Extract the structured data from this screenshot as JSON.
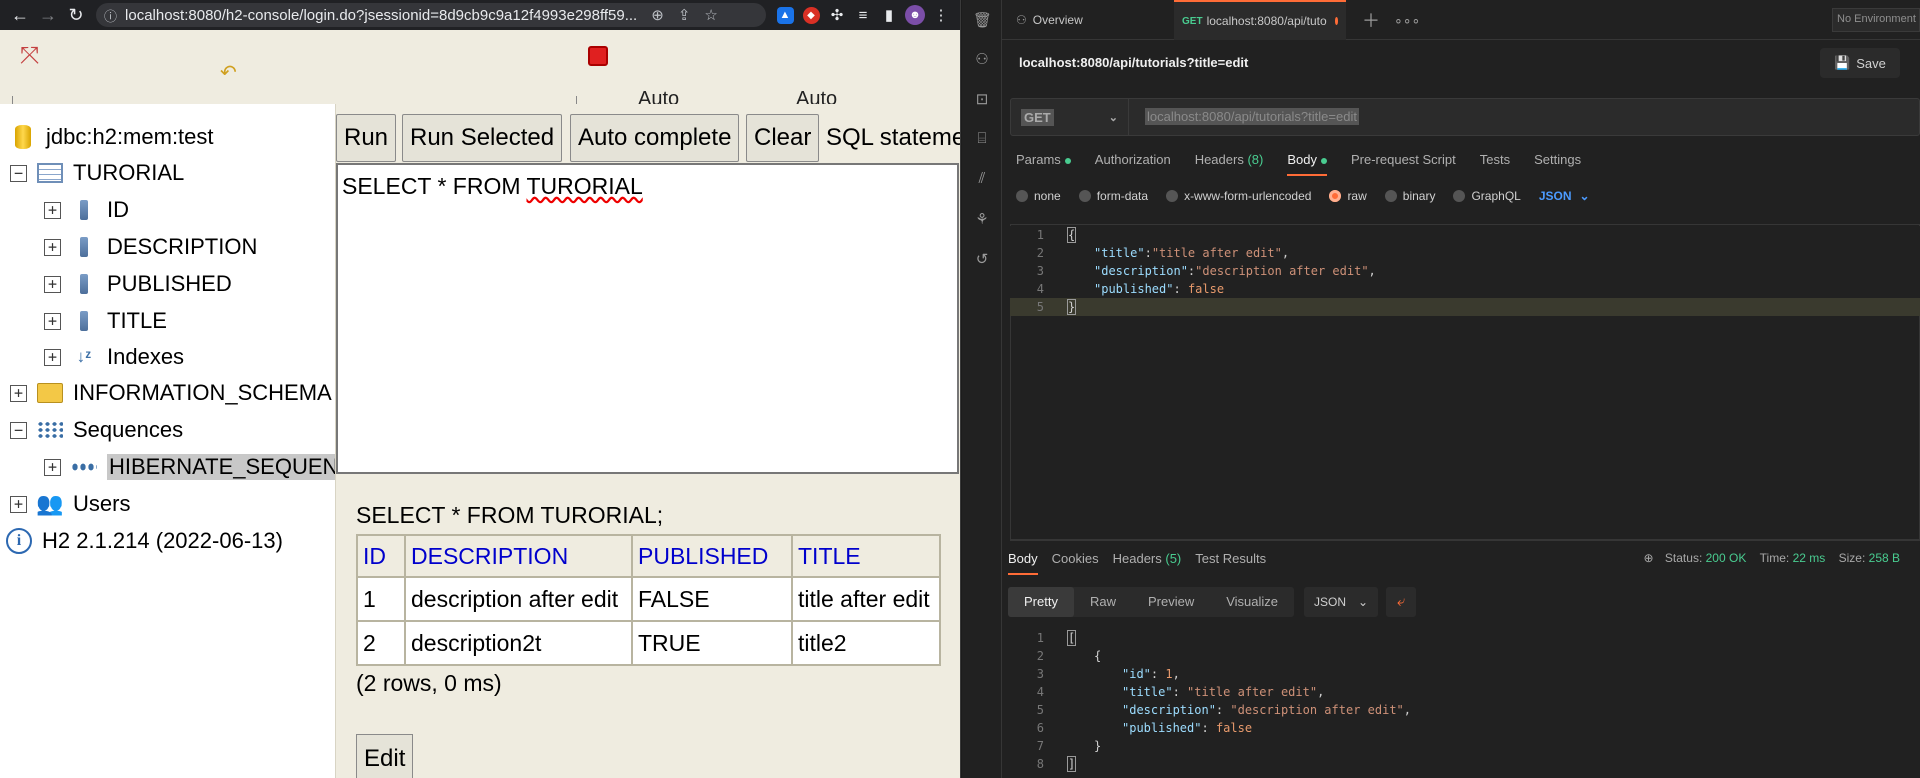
{
  "browser": {
    "url": "localhost:8080/h2-console/login.do?jsessionid=8d9cb9c9a12f4993e298ff59..."
  },
  "h2": {
    "toolbar": {
      "auto1": "Auto",
      "auto2": "Auto"
    },
    "tree": {
      "connection": "jdbc:h2:mem:test",
      "table": "TURORIAL",
      "columns": [
        "ID",
        "DESCRIPTION",
        "PUBLISHED",
        "TITLE"
      ],
      "indexes": "Indexes",
      "info_schema": "INFORMATION_SCHEMA",
      "sequences": "Sequences",
      "sequence_item": "HIBERNATE_SEQUENCE",
      "users": "Users",
      "version": "H2 2.1.214 (2022-06-13)"
    },
    "buttons": {
      "run": "Run",
      "run_selected": "Run Selected",
      "auto_complete": "Auto complete",
      "clear": "Clear",
      "sql_label": "SQL statement:",
      "edit": "Edit"
    },
    "editor": {
      "keyword": "SELECT * FROM ",
      "table": "TURORIAL"
    },
    "result": {
      "statement": "SELECT * FROM TURORIAL;",
      "columns": [
        "ID",
        "DESCRIPTION",
        "PUBLISHED",
        "TITLE"
      ],
      "rows": [
        [
          "1",
          "description after edit",
          "FALSE",
          "title after edit"
        ],
        [
          "2",
          "description2t",
          "TRUE",
          "title2"
        ]
      ],
      "footer": "(2 rows, 0 ms)"
    }
  },
  "postman": {
    "tabs": {
      "overview": "Overview",
      "active_method": "GET",
      "active_label": "localhost:8080/api/tuto"
    },
    "environment": "No Environment",
    "title": "localhost:8080/api/tutorials?title=edit",
    "save": "Save",
    "method": "GET",
    "url": "localhost:8080/api/tutorials?title=edit",
    "request_tabs": {
      "params": "Params",
      "authorization": "Authorization",
      "headers": "Headers",
      "headers_count": "(8)",
      "body": "Body",
      "prerequest": "Pre-request Script",
      "tests": "Tests",
      "settings": "Settings"
    },
    "body_options": {
      "none": "none",
      "form_data": "form-data",
      "urlencoded": "x-www-form-urlencoded",
      "raw": "raw",
      "binary": "binary",
      "graphql": "GraphQL",
      "json": "JSON"
    },
    "request_body": {
      "ln": [
        "1",
        "2",
        "3",
        "4",
        "5"
      ],
      "open": "{",
      "close": "}",
      "title_key": "\"title\"",
      "title_val": "\"title after edit\"",
      "desc_key": "\"description\"",
      "desc_val": "\"description after edit\"",
      "pub_key": "\"published\"",
      "pub_val": "false"
    },
    "response_tabs": {
      "body": "Body",
      "cookies": "Cookies",
      "headers": "Headers",
      "headers_count": "(5)",
      "test_results": "Test Results"
    },
    "response_meta": {
      "status_label": "Status:",
      "status": "200 OK",
      "time_label": "Time:",
      "time": "22 ms",
      "size_label": "Size:",
      "size": "258 B"
    },
    "response_view": {
      "pretty": "Pretty",
      "raw": "Raw",
      "preview": "Preview",
      "visualize": "Visualize",
      "format": "JSON"
    },
    "response_body": {
      "ln": [
        "1",
        "2",
        "3",
        "4",
        "5",
        "6",
        "7",
        "8"
      ],
      "arr_open": "[",
      "obj_open": "{",
      "id_key": "\"id\"",
      "id_val": "1",
      "title_key": "\"title\"",
      "title_val": "\"title after edit\"",
      "desc_key": "\"description\"",
      "desc_val": "\"description after edit\"",
      "pub_key": "\"published\"",
      "pub_val": "false",
      "obj_close": "}",
      "arr_close": "]"
    }
  }
}
